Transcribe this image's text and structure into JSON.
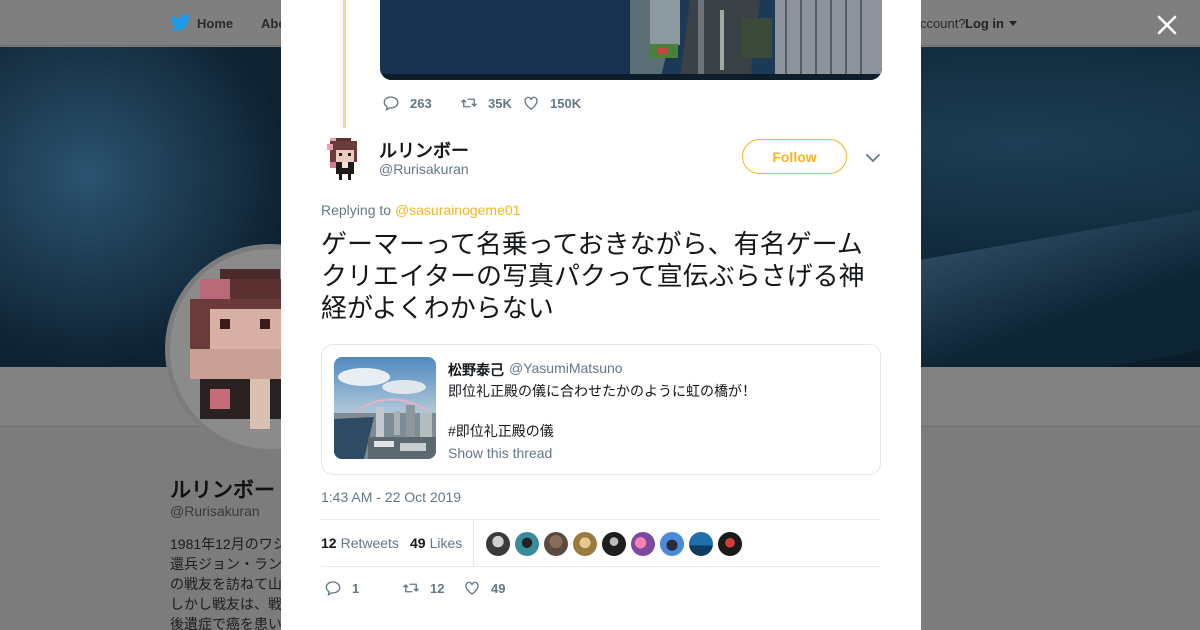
{
  "nav": {
    "home_label": "Home",
    "about_label": "Abo",
    "account_prompt": "ccount?",
    "login_label": "Log in"
  },
  "profile": {
    "name": "ルリンボー",
    "handle": "@Rurisakuran",
    "bio_lines": [
      "1981年12月のワシ",
      "還兵ジョン・ラン",
      "の戦友を訪ねて山",
      "しかし戦友は、戦",
      "後遺症で癌を患い"
    ]
  },
  "previous_tweet": {
    "replies": "263",
    "retweets": "35K",
    "likes": "150K"
  },
  "tweet": {
    "author_name": "ルリンボー",
    "author_handle": "@Rurisakuran",
    "follow_label": "Follow",
    "replying_prefix": "Replying to",
    "replying_to": "@sasurainogeme01",
    "text": "ゲーマーって名乗っておきながら、有名ゲームクリエイターの写真パクって宣伝ぶらさげる神経がよくわからない",
    "timestamp": "1:43 AM - 22 Oct 2019",
    "retweet_count": "12",
    "retweet_label": "Retweets",
    "like_count": "49",
    "like_label": "Likes",
    "reply_action_count": "1",
    "retweet_action_count": "12",
    "like_action_count": "49"
  },
  "quoted": {
    "name": "松野泰己",
    "handle": "@YasumiMatsuno",
    "line1": "即位礼正殿の儀に合わせたかのように虹の橋が！",
    "line2": "#即位礼正殿の儀",
    "show_thread": "Show this thread"
  },
  "colors": {
    "accent": "#f4b522",
    "thread_line": "#fdd597",
    "muted": "#657786"
  }
}
